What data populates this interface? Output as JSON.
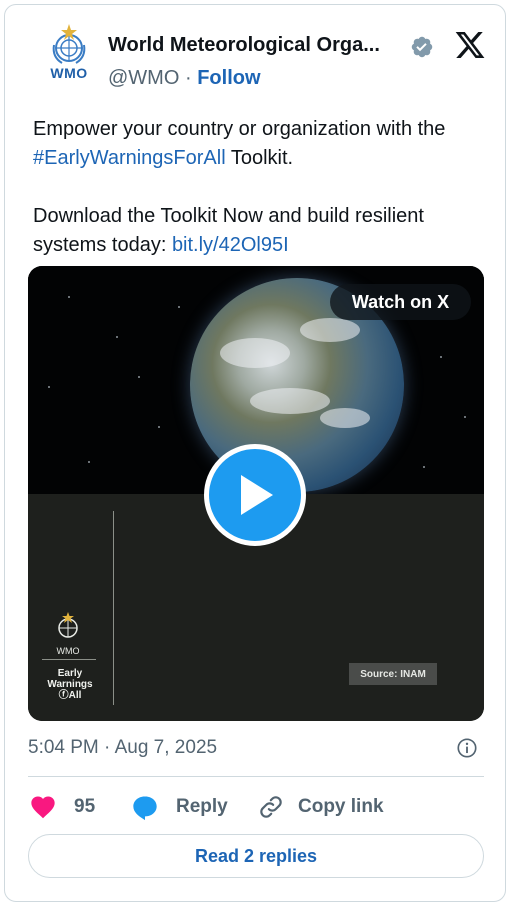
{
  "author": {
    "avatar_label": "WMO",
    "name": "World Meteorological Orga...",
    "handle": "@WMO",
    "separator": "·",
    "follow_label": "Follow"
  },
  "tweet": {
    "line1": "Empower your country or organization with the",
    "hashtag": "#EarlyWarningsForAll",
    "line1_tail": " Toolkit.",
    "line2": "Download the Toolkit Now and build resilient systems today: ",
    "link": "bit.ly/42Ol95I"
  },
  "media": {
    "watch_label": "Watch on X",
    "wmo_label": "WMO",
    "ew_line1": "Early",
    "ew_line2": "Warnings",
    "ew_line3": "ⓕAll",
    "source_label": "Source: INAM"
  },
  "meta": {
    "timestamp": "5:04 PM · Aug 7, 2025"
  },
  "actions": {
    "like_count": "95",
    "reply_label": "Reply",
    "copy_label": "Copy link"
  },
  "read_replies_label": "Read 2 replies",
  "colors": {
    "link": "#1d65b5",
    "like": "#f91880",
    "reply": "#1d9bf0",
    "play": "#1d9bf0"
  }
}
